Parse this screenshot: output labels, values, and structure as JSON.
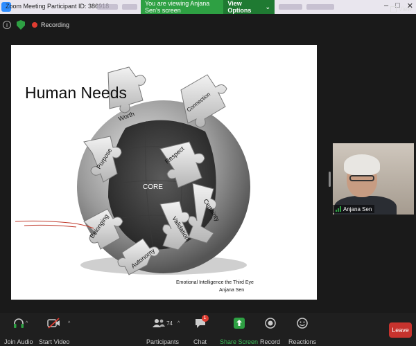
{
  "window": {
    "title": "Zoom Meeting Participant ID: 386918",
    "controls": [
      "–",
      "□",
      "✕"
    ]
  },
  "share_banner": {
    "message": "You are viewing Anjana Sen's screen",
    "view_options": "View Options",
    "caret": "⌄"
  },
  "top_bar": {
    "info_glyph": "i",
    "recording_label": "Recording",
    "view_label": "View"
  },
  "slide": {
    "title": "Human Needs",
    "core_label": "CORE",
    "pieces": [
      "Worth",
      "Connection",
      "Purpose",
      "Respect",
      "Certainty",
      "Belonging",
      "Validation",
      "Autonomy"
    ],
    "credit_line": "Emotional Intelligence the Third Eye",
    "credit_author": "Anjana Sen"
  },
  "participant_video": {
    "name": "Anjana Sen"
  },
  "toolbar": {
    "join_audio": "Join Audio",
    "start_video": "Start Video",
    "participants": "Participants",
    "participants_count": "74",
    "chat": "Chat",
    "chat_badge": "1",
    "share_screen": "Share Screen",
    "record": "Record",
    "reactions": "Reactions",
    "leave": "Leave",
    "caret": "^"
  },
  "colors": {
    "banner_green": "#2ea043",
    "share_green": "#2ea043",
    "leave_red": "#c7332e",
    "recording_red": "#e03c31"
  },
  "icons": {
    "info": "info-icon",
    "security": "shield-icon",
    "audio": "headphones-icon",
    "video": "video-off-icon",
    "participants": "people-icon",
    "chat": "chat-bubble-icon",
    "share": "share-arrow-icon",
    "record": "record-icon",
    "reactions": "smiley-icon"
  }
}
